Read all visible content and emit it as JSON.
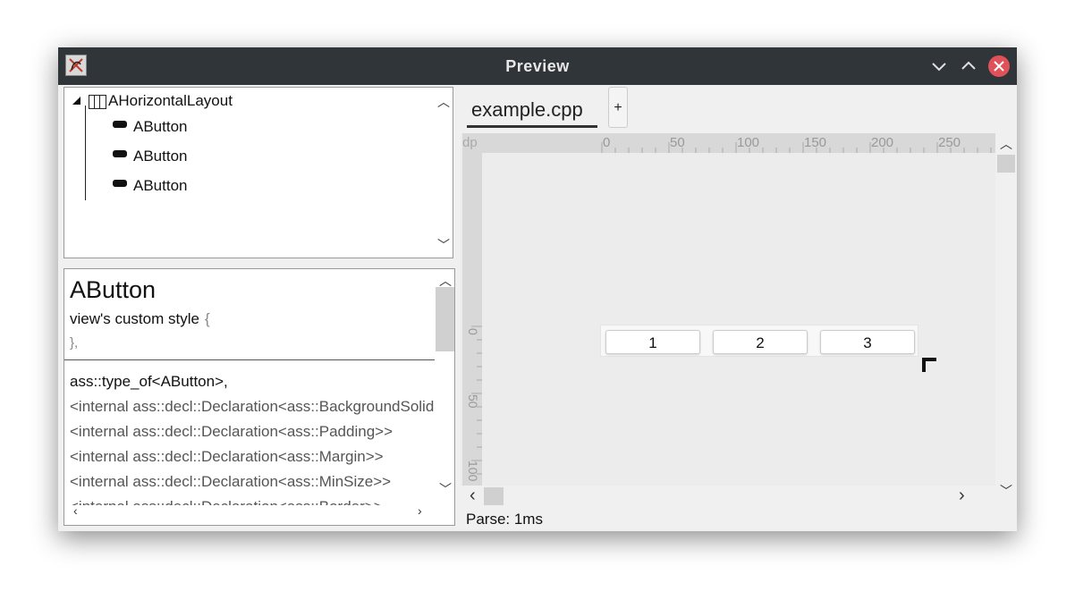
{
  "window": {
    "title": "Preview"
  },
  "tree": {
    "root": "AHorizontalLayout",
    "children": [
      "AButton",
      "AButton",
      "AButton"
    ]
  },
  "properties": {
    "name": "AButton",
    "style_label": "view's custom style",
    "open_brace": "{",
    "close_brace": "},",
    "lines": [
      "ass::type_of<AButton>,",
      "<internal ass::decl::Declaration<ass::BackgroundSolid>>",
      "<internal ass::decl::Declaration<ass::Padding>>",
      "<internal ass::decl::Declaration<ass::Margin>>",
      "<internal ass::decl::Declaration<ass::MinSize>>",
      "<internal ass::decl::Declaration<ass::Border>>"
    ]
  },
  "tabs": {
    "active": "example.cpp",
    "add": "+"
  },
  "ruler": {
    "unit": "dp",
    "top_ticks": [
      "0",
      "50",
      "100",
      "150",
      "200",
      "250"
    ],
    "left_ticks": [
      "0",
      "50",
      "100"
    ]
  },
  "preview": {
    "buttons": [
      "1",
      "2",
      "3"
    ]
  },
  "status": {
    "text": "Parse: 1ms"
  }
}
